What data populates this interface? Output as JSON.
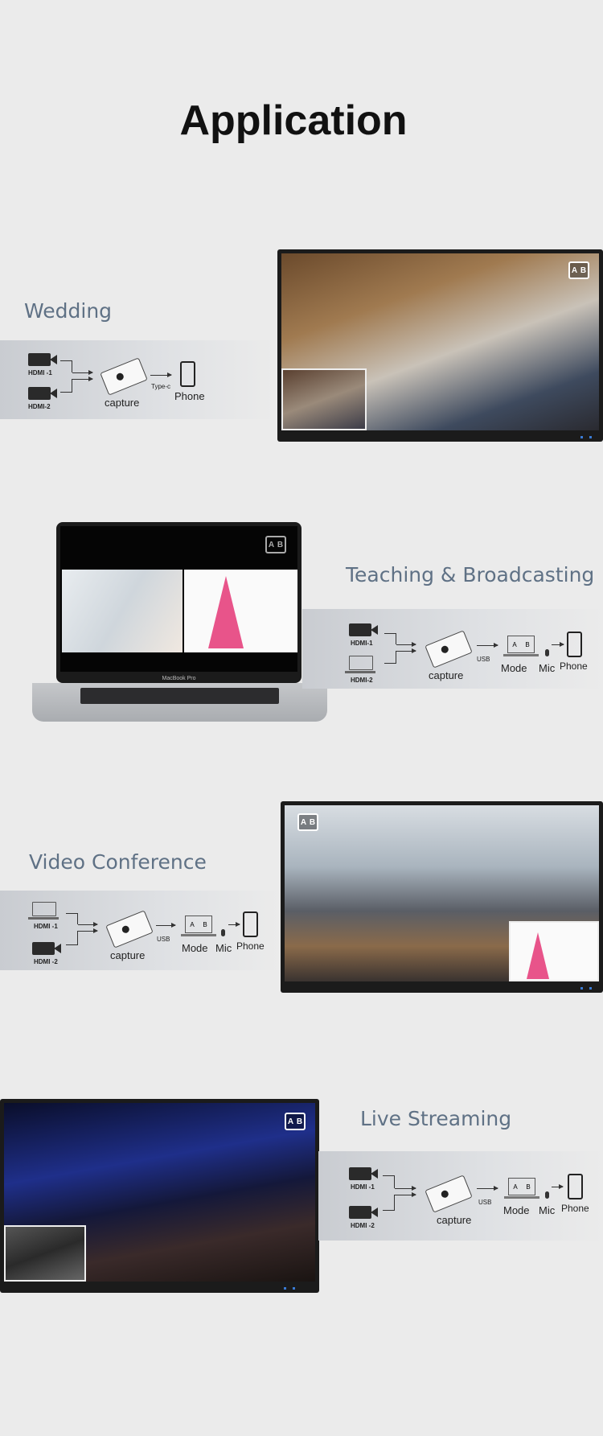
{
  "title": "Application",
  "sections": [
    {
      "label": "Wedding",
      "inputs": [
        "HDMI -1",
        "HDMI-2"
      ],
      "device": "capture",
      "link": "Type-c",
      "output": "Phone"
    },
    {
      "label": "Teaching & Broadcasting",
      "inputs": [
        "HDMI-1",
        "HDMI-2"
      ],
      "device": "capture",
      "link": "USB",
      "mode": "Mode",
      "mic": "Mic",
      "output": "Phone",
      "mode_a": "A",
      "mode_b": "B",
      "laptop_brand": "MacBook Pro"
    },
    {
      "label": "Video Conference",
      "inputs": [
        "HDMI -1",
        "HDMI -2"
      ],
      "device": "capture",
      "link": "USB",
      "mode": "Mode",
      "mic": "Mic",
      "output": "Phone",
      "mode_a": "A",
      "mode_b": "B"
    },
    {
      "label": "Live Streaming",
      "inputs": [
        "HDMI -1",
        "HDMI -2"
      ],
      "device": "capture",
      "link": "USB",
      "mode": "Mode",
      "mic": "Mic",
      "output": "Phone",
      "mode_a": "A",
      "mode_b": "B"
    }
  ],
  "ab_badge": {
    "a": "A",
    "b": "B"
  },
  "colors": {
    "label": "#5f7185",
    "indicator": "#3a7bd5"
  }
}
